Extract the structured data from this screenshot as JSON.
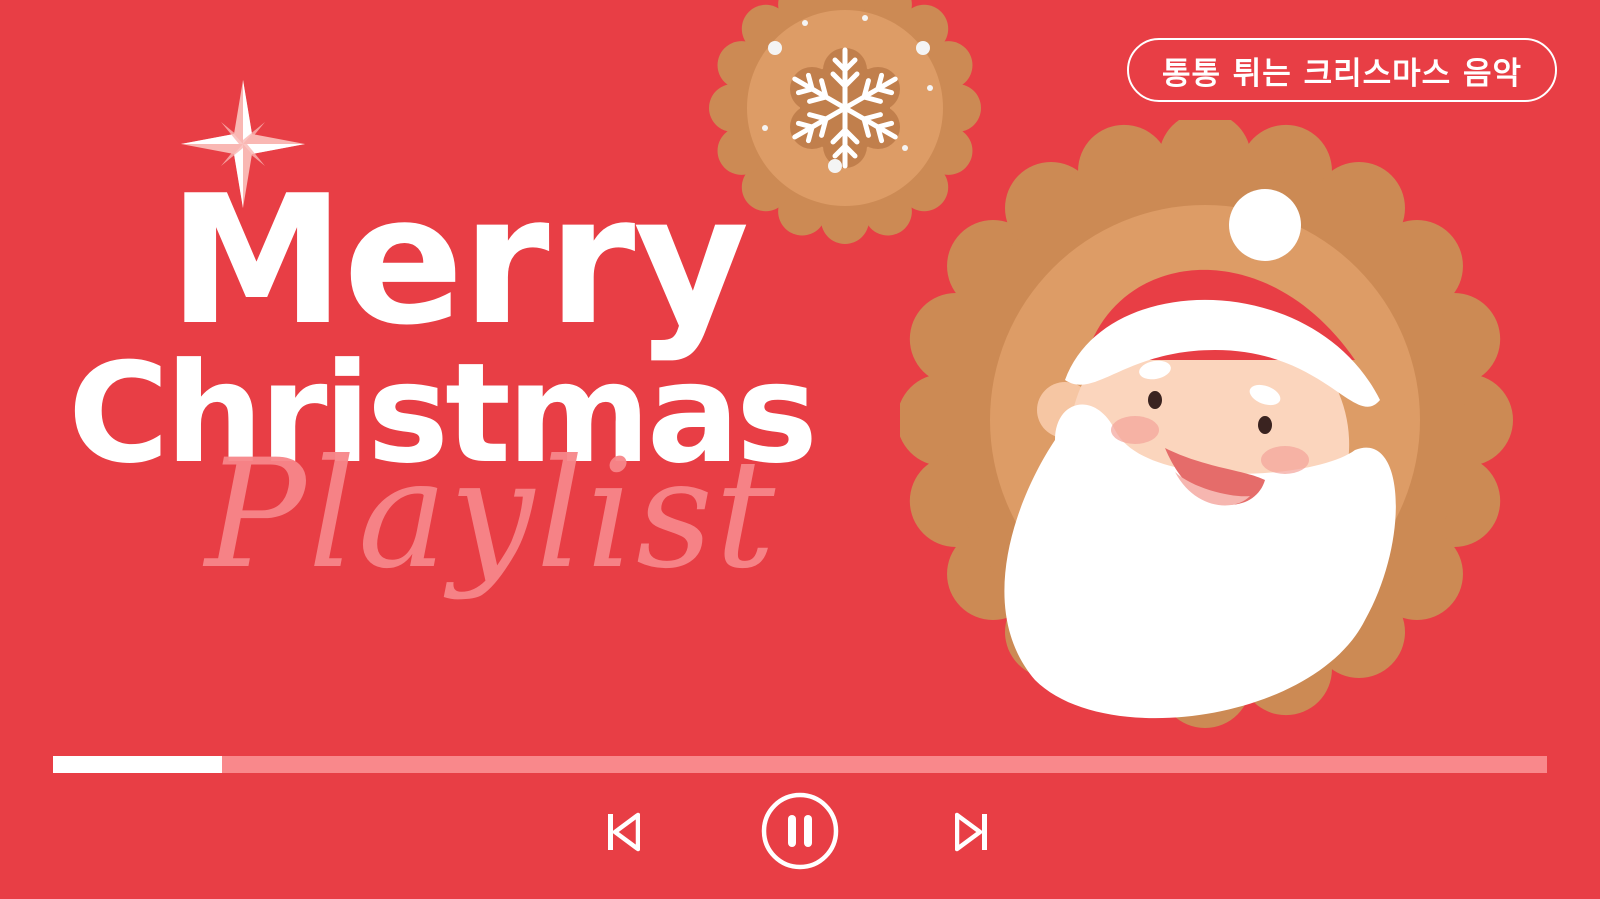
{
  "tag": {
    "label": "통통 튀는 크리스마스 음악"
  },
  "title": {
    "line1": "Merry",
    "line2": "Christmas",
    "line3": "Playlist"
  },
  "player": {
    "progress": 0.113,
    "controls": [
      {
        "name": "previous",
        "icon": "skip-previous-icon"
      },
      {
        "name": "pause",
        "icon": "pause-icon"
      },
      {
        "name": "next",
        "icon": "skip-next-icon"
      }
    ]
  },
  "colors": {
    "background": "#e83e45",
    "cookie": "#cc8a54",
    "cookie_inner": "#dd9c66",
    "white": "#ffffff",
    "pink": "#f7868a",
    "track": "#f9888b"
  },
  "decorations": {
    "star": "four-point-star-icon",
    "snowflake_cookie": "snowflake-cookie-icon",
    "santa": "santa-face-illustration"
  }
}
